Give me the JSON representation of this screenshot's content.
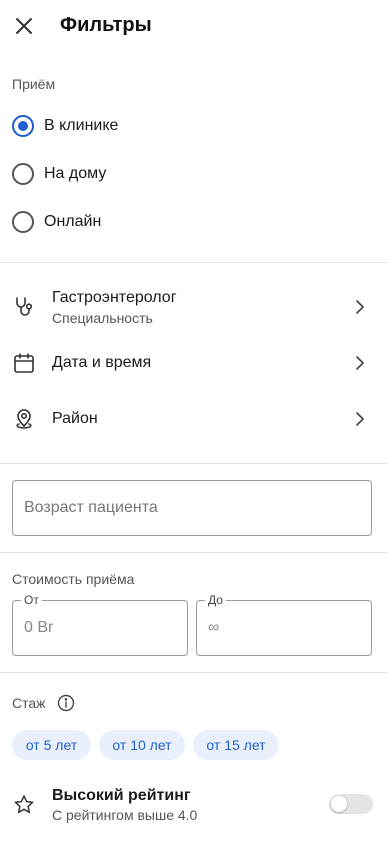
{
  "header": {
    "title": "Фильтры",
    "close_icon": "close-icon"
  },
  "appointment": {
    "label": "Приём",
    "options": [
      {
        "label": "В клинике",
        "checked": true
      },
      {
        "label": "На дому",
        "checked": false
      },
      {
        "label": "Онлайн",
        "checked": false
      }
    ]
  },
  "nav": {
    "specialty": {
      "title": "Гастроэнтеролог",
      "subtitle": "Специальность",
      "icon": "stethoscope-icon"
    },
    "datetime": {
      "title": "Дата и время",
      "icon": "calendar-icon"
    },
    "district": {
      "title": "Район",
      "icon": "location-pin-icon"
    }
  },
  "patient_age": {
    "placeholder": "Возраст пациента"
  },
  "price": {
    "label": "Стоимость приёма",
    "from": {
      "legend": "От",
      "placeholder": "0 Br"
    },
    "to": {
      "legend": "До",
      "placeholder": "∞"
    }
  },
  "experience": {
    "label": "Стаж",
    "chips": [
      "от 5 лет",
      "от 10 лет",
      "от 15 лет"
    ]
  },
  "rating": {
    "title": "Высокий рейтинг",
    "subtitle": "С рейтингом выше 4.0",
    "enabled": false
  },
  "colors": {
    "accent": "#1f5fcf",
    "chip_bg": "#eaf0fb",
    "divider": "#e2e2e2"
  }
}
